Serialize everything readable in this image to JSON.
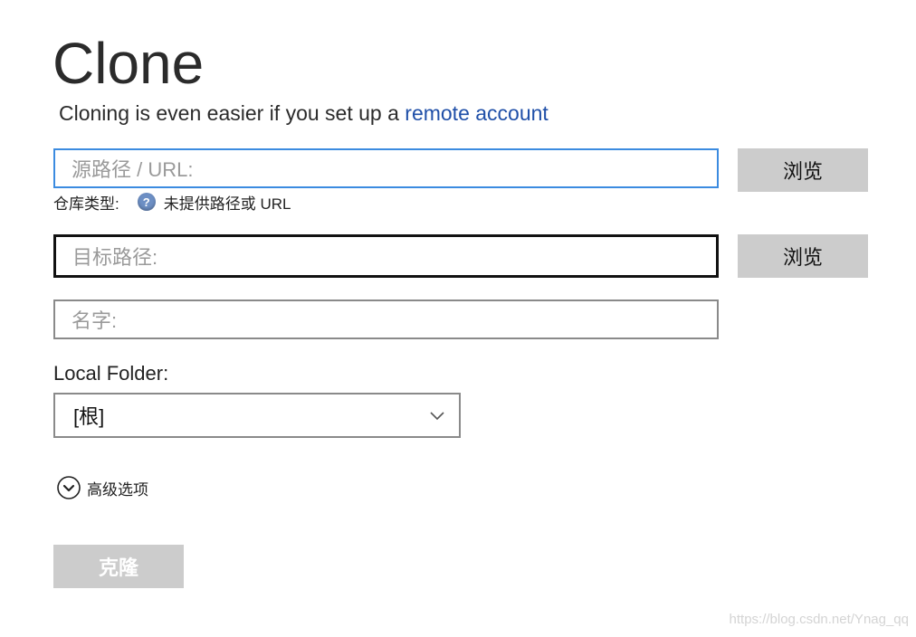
{
  "title": "Clone",
  "subtitle": {
    "text": "Cloning is even easier if you set up a",
    "link": "remote account"
  },
  "source_field": {
    "placeholder": "源路径 / URL:",
    "browse_label": "浏览"
  },
  "repo_type": {
    "label": "仓库类型:",
    "help_icon_text": "?",
    "status": "未提供路径或 URL"
  },
  "target_field": {
    "placeholder": "目标路径:",
    "browse_label": "浏览"
  },
  "name_field": {
    "placeholder": "名字:"
  },
  "local_folder": {
    "label": "Local Folder:",
    "selected": "[根]"
  },
  "advanced": {
    "label": "高级选项"
  },
  "clone_button": {
    "label": "克隆",
    "enabled": false
  },
  "watermark": "https://blog.csdn.net/Ynag_qq",
  "colors": {
    "focus_border": "#3b8be0",
    "link": "#1f4fa8",
    "button_bg": "#cccccc",
    "help_icon": "#6d8fc4"
  },
  "icons": [
    "help-icon",
    "chevron-down-icon",
    "expand-circle-icon"
  ]
}
